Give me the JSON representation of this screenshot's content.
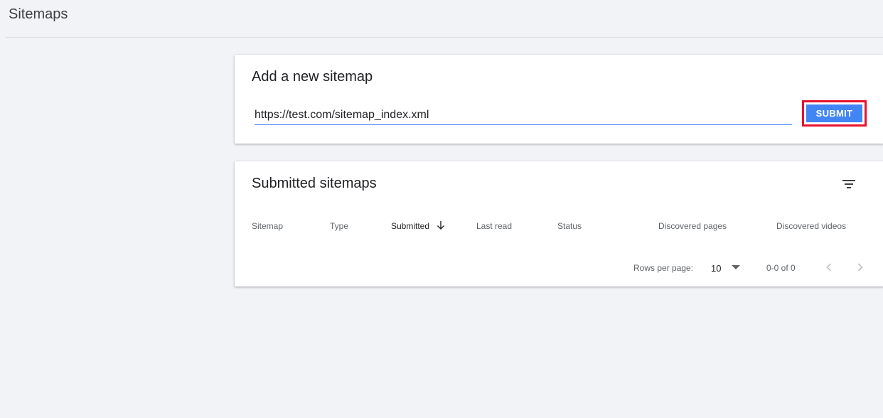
{
  "header": {
    "title": "Sitemaps"
  },
  "add_sitemap": {
    "title": "Add a new sitemap",
    "input_value": "https://test.com/sitemap_index.xml",
    "submit_label": "SUBMIT",
    "submit_color": "#4285f4",
    "highlight_color": "#e8112d"
  },
  "submitted_sitemaps": {
    "title": "Submitted sitemaps",
    "filter_icon": "filter-icon",
    "columns": {
      "sitemap": "Sitemap",
      "type": "Type",
      "submitted": "Submitted",
      "last_read": "Last read",
      "status": "Status",
      "discovered_pages": "Discovered pages",
      "discovered_videos": "Discovered videos"
    },
    "sort_icon": "arrow-down-icon",
    "pagination": {
      "rows_per_page_label": "Rows per page:",
      "rows_per_page_value": "10",
      "range": "0-0 of 0"
    }
  }
}
